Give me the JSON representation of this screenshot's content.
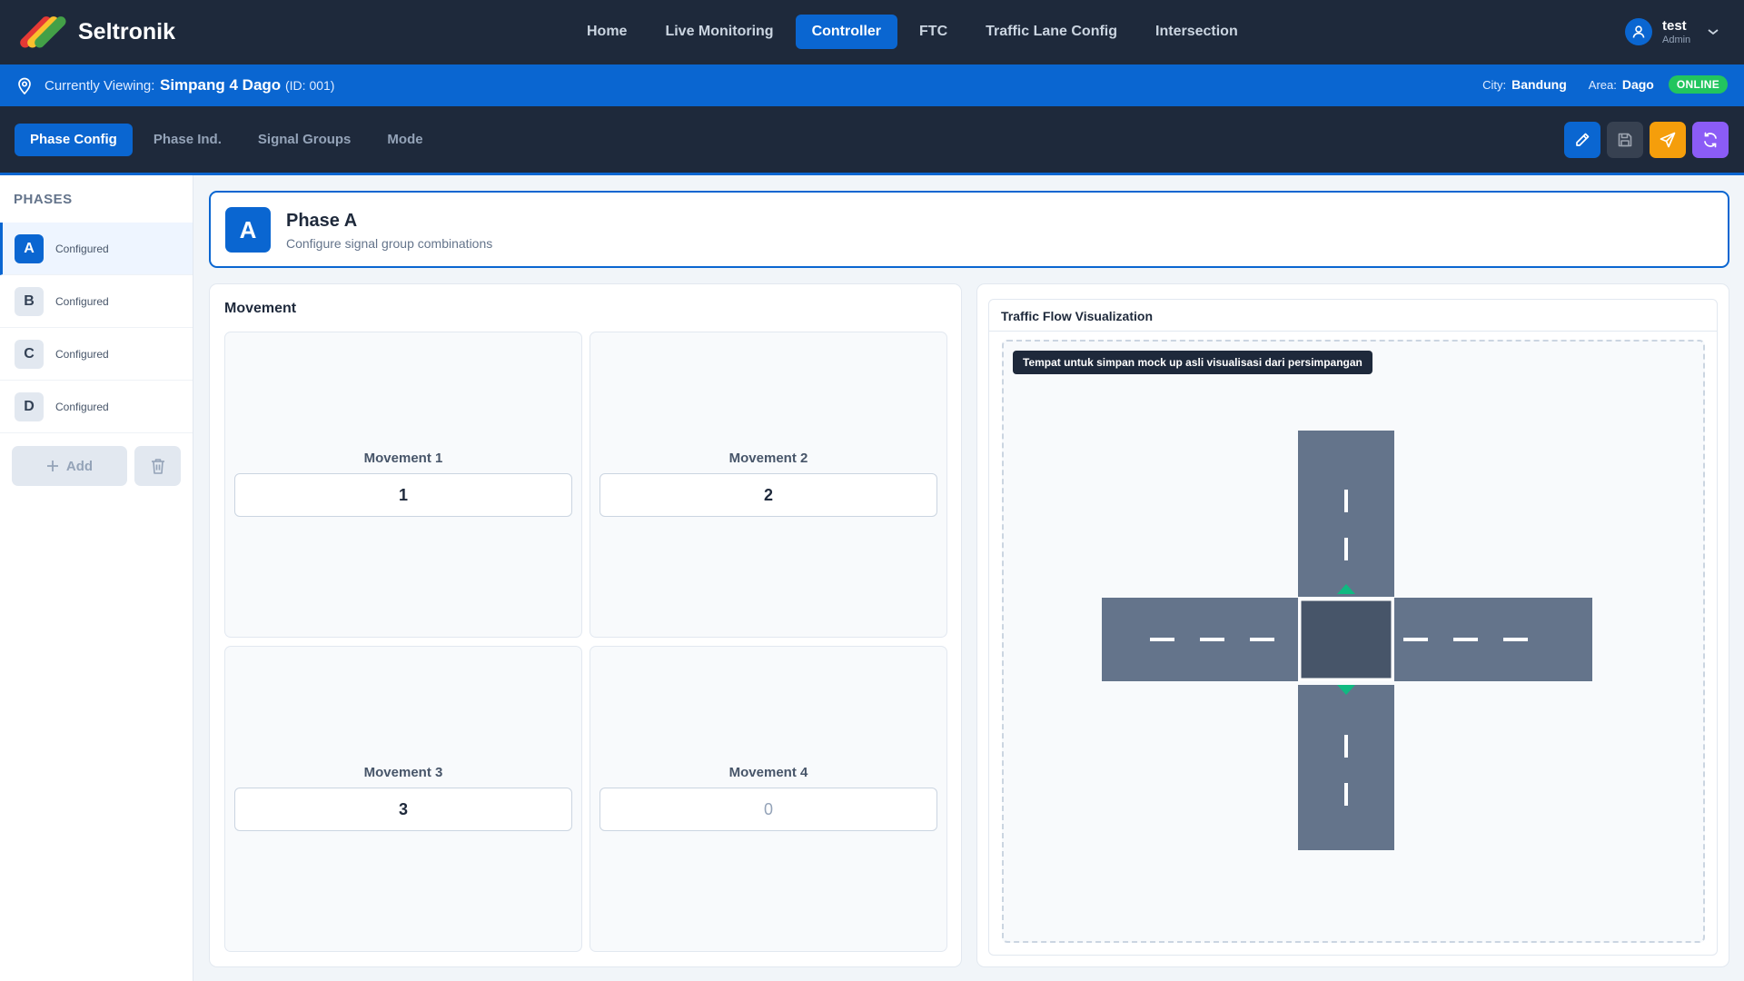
{
  "app": {
    "brand": "Seltronik",
    "nav": [
      "Home",
      "Live Monitoring",
      "Controller",
      "FTC",
      "Traffic Lane Config",
      "Intersection"
    ],
    "nav_active": "Controller",
    "user": {
      "name": "test",
      "role": "Admin"
    }
  },
  "viewing": {
    "label": "Currently Viewing:",
    "name": "Simpang 4 Dago",
    "id": "(ID: 001)",
    "city_label": "City:",
    "city": "Bandung",
    "area_label": "Area:",
    "area": "Dago",
    "status": "ONLINE"
  },
  "subtabs": [
    "Phase Config",
    "Phase Ind.",
    "Signal Groups",
    "Mode"
  ],
  "subtab_active": "Phase Config",
  "sidebar": {
    "title": "PHASES",
    "phases": [
      {
        "letter": "A",
        "status": "Configured",
        "active": true
      },
      {
        "letter": "B",
        "status": "Configured",
        "active": false
      },
      {
        "letter": "C",
        "status": "Configured",
        "active": false
      },
      {
        "letter": "D",
        "status": "Configured",
        "active": false
      }
    ],
    "add_label": "Add"
  },
  "phase": {
    "letter": "A",
    "title": "Phase A",
    "subtitle": "Configure signal group combinations"
  },
  "movement": {
    "title": "Movement",
    "items": [
      {
        "label": "Movement 1",
        "value": "1",
        "placeholder": "0"
      },
      {
        "label": "Movement 2",
        "value": "2",
        "placeholder": "0"
      },
      {
        "label": "Movement 3",
        "value": "3",
        "placeholder": "0"
      },
      {
        "label": "Movement 4",
        "value": "",
        "placeholder": "0"
      }
    ]
  },
  "visualization": {
    "title": "Traffic Flow Visualization",
    "tooltip": "Tempat untuk simpan mock up asli visualisasi dari persimpangan"
  },
  "colors": {
    "primary": "#0a66d1",
    "nav_bg": "#1e293b",
    "online": "#22c55e",
    "road": "#64748b",
    "road_center": "#475569",
    "flow_arrow": "#10b981",
    "send": "#f59e0b",
    "sync": "#8b5cf6"
  }
}
